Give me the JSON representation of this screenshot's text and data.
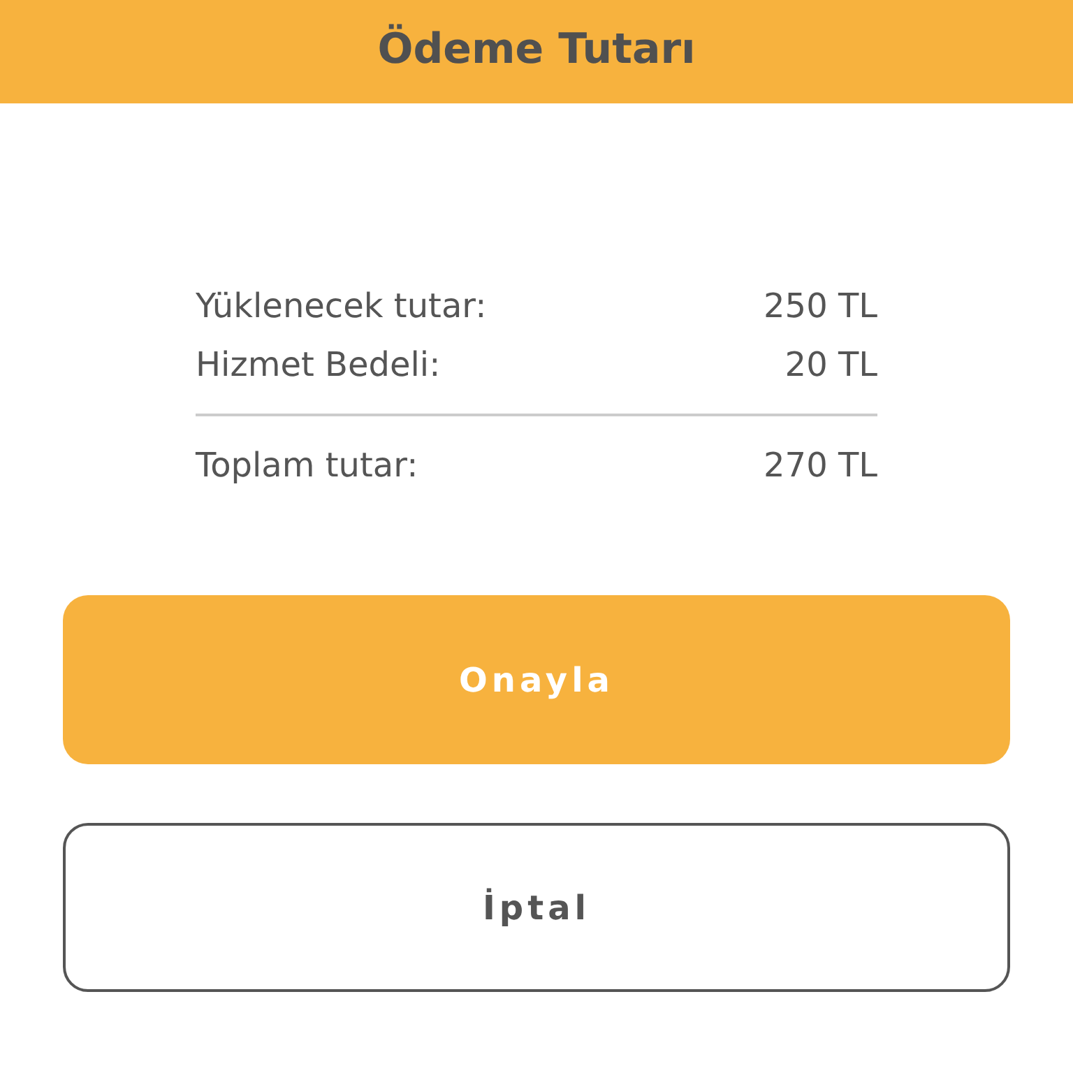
{
  "header": {
    "title": "Ödeme Tutarı"
  },
  "summary": {
    "lines": [
      {
        "label": "Yüklenecek tutar:",
        "value": "250 TL"
      },
      {
        "label": "Hizmet Bedeli:",
        "value": "20 TL"
      }
    ],
    "total": {
      "label": "Toplam tutar:",
      "value": "270 TL"
    }
  },
  "buttons": [
    {
      "label": "Onayla",
      "kind": "primary"
    },
    {
      "label": "İptal",
      "kind": "outline"
    }
  ]
}
